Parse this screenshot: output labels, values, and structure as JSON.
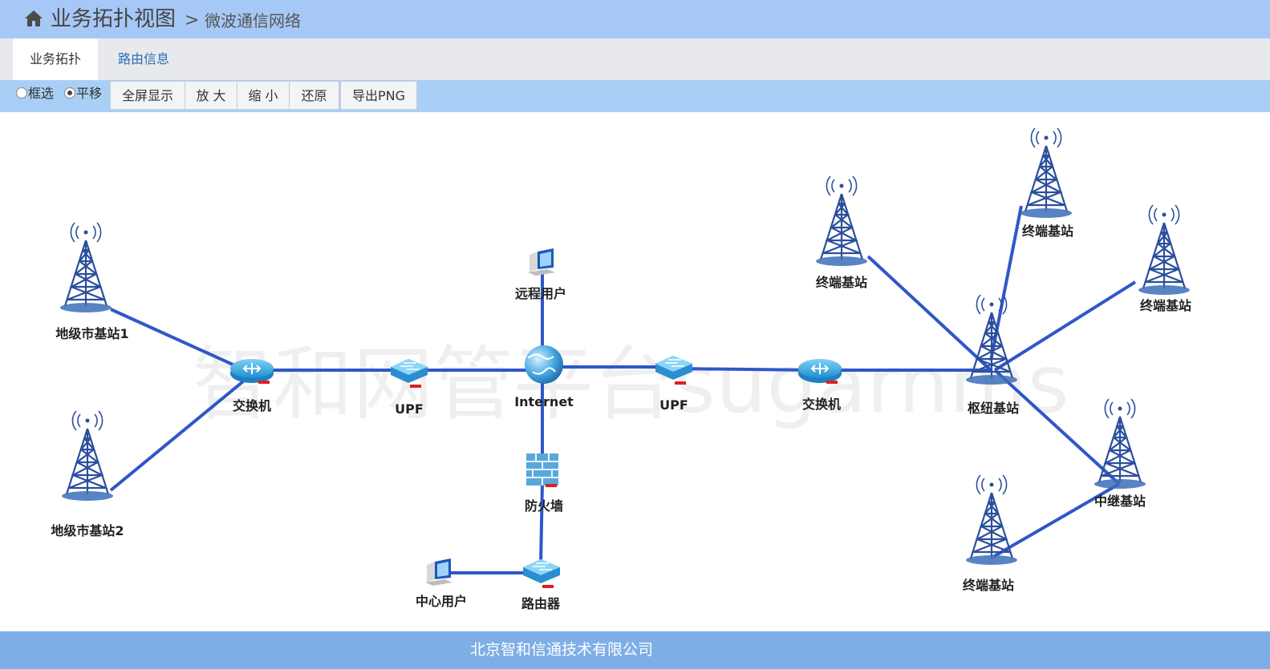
{
  "header": {
    "home_icon": "home-icon",
    "title": "业务拓扑视图",
    "separator": ">",
    "breadcrumb": "微波通信网络"
  },
  "tabs": [
    {
      "label": "业务拓扑",
      "active": true
    },
    {
      "label": "路由信息",
      "active": false
    }
  ],
  "toolbar": {
    "radios": [
      {
        "label": "框选",
        "checked": false
      },
      {
        "label": "平移",
        "checked": true
      }
    ],
    "buttons": [
      "全屏显示",
      "放 大",
      "缩 小",
      "还原",
      "导出PNG"
    ]
  },
  "topology": {
    "watermark": "智和网管平台sugarnms",
    "nodes": [
      {
        "id": "base1",
        "label": "地级市基站1",
        "icon": "tower-icon"
      },
      {
        "id": "base2",
        "label": "地级市基站2",
        "icon": "tower-icon"
      },
      {
        "id": "sw_left",
        "label": "交换机",
        "icon": "switch-icon"
      },
      {
        "id": "upf_left",
        "label": "UPF",
        "icon": "upf-icon"
      },
      {
        "id": "internet",
        "label": "Internet",
        "icon": "globe-icon"
      },
      {
        "id": "remote",
        "label": "远程用户",
        "icon": "computer-icon"
      },
      {
        "id": "firewall",
        "label": "防火墙",
        "icon": "firewall-icon"
      },
      {
        "id": "router",
        "label": "路由器",
        "icon": "router-icon"
      },
      {
        "id": "center",
        "label": "中心用户",
        "icon": "computer-icon"
      },
      {
        "id": "upf_right",
        "label": "UPF",
        "icon": "upf-icon"
      },
      {
        "id": "sw_right",
        "label": "交换机",
        "icon": "switch-icon"
      },
      {
        "id": "hub",
        "label": "枢纽基站",
        "icon": "tower-icon"
      },
      {
        "id": "term1",
        "label": "终端基站",
        "icon": "tower-icon"
      },
      {
        "id": "term2",
        "label": "终端基站",
        "icon": "tower-icon"
      },
      {
        "id": "term3",
        "label": "终端基站",
        "icon": "tower-icon"
      },
      {
        "id": "relay",
        "label": "中继基站",
        "icon": "tower-icon"
      },
      {
        "id": "term4",
        "label": "终端基站",
        "icon": "tower-icon"
      }
    ],
    "links": [
      [
        "base1",
        "sw_left"
      ],
      [
        "base2",
        "sw_left"
      ],
      [
        "sw_left",
        "upf_left"
      ],
      [
        "upf_left",
        "internet"
      ],
      [
        "internet",
        "remote"
      ],
      [
        "internet",
        "firewall"
      ],
      [
        "firewall",
        "router"
      ],
      [
        "router",
        "center"
      ],
      [
        "internet",
        "upf_right"
      ],
      [
        "upf_right",
        "sw_right"
      ],
      [
        "sw_right",
        "hub"
      ],
      [
        "hub",
        "term1"
      ],
      [
        "hub",
        "term2"
      ],
      [
        "hub",
        "term3"
      ],
      [
        "hub",
        "relay"
      ],
      [
        "relay",
        "term4"
      ]
    ]
  },
  "colors": {
    "header_bg": "#a6c8f6",
    "toolbar_bg": "#a9cff6",
    "footer_bg": "#7eaee6",
    "link": "#2f57c9",
    "device_blue": "#35a6dd",
    "tower_blue": "#2b4f9c"
  },
  "footer": {
    "company": "北京智和信通技术有限公司"
  }
}
